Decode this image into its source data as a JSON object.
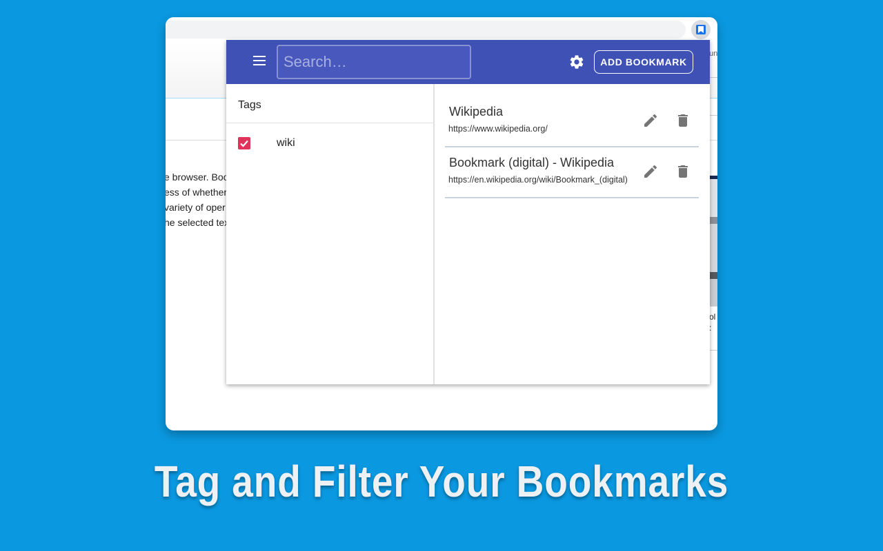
{
  "background_color": "#0a98e0",
  "browser": {
    "extension_icon": "bookmark-icon",
    "page_text_lines": [
      "e browser. Book",
      "ess of whether",
      "variety of oper",
      "he selected tex"
    ],
    "right_header_text": "unt",
    "right_caption_lines": [
      "ol",
      ":"
    ]
  },
  "popup": {
    "accent_color": "#3f51b5",
    "menu_icon": "menu-icon",
    "search": {
      "placeholder": "Search…",
      "value": ""
    },
    "settings_icon": "gear-icon",
    "add_bookmark_label": "ADD BOOKMARK",
    "tags": {
      "title": "Tags",
      "items": [
        {
          "label": "wiki",
          "checked": true,
          "check_color": "#e0325a"
        }
      ]
    },
    "bookmarks": [
      {
        "title": "Wikipedia",
        "url": "https://www.wikipedia.org/"
      },
      {
        "title": "Bookmark (digital) - Wikipedia",
        "url": "https://en.wikipedia.org/wiki/Bookmark_(digital)"
      }
    ]
  },
  "banner": {
    "text": "Tag and Filter Your Bookmarks"
  }
}
